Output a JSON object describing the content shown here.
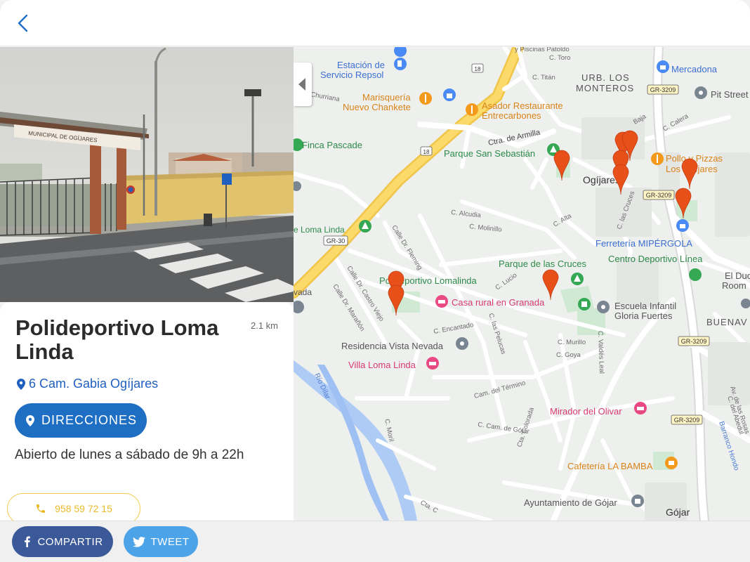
{
  "place": {
    "name": "Polideportivo Loma Linda",
    "distance": "2.1 km",
    "address": "6 Cam. Gabia Ogíjares",
    "directions_label": "DIRECCIONES",
    "hours": "Abierto de lunes a sábado de 9h a 22h",
    "phone": "958 59 72 15"
  },
  "photo": {
    "sign_text": "MUNICIPAL DE OGÍJARES"
  },
  "share": {
    "facebook_label": "COMPARTIR",
    "twitter_label": "TWEET"
  },
  "colors": {
    "primary": "#1e6fc4",
    "facebook": "#3b5998",
    "twitter": "#4da3e8",
    "phone": "#e9b928",
    "marker": "#e8501a"
  },
  "map": {
    "pois": {
      "repsol": "Estación de Servicio Repsol",
      "repsol_1": "Estación de",
      "repsol_2": "Servicio Repsol",
      "marisqueria_1": "Marisquería",
      "marisqueria_2": "Nuevo Chankete",
      "asador_1": "Asador Restaurante",
      "asador_2": "Entrecarbones",
      "finca": "Finca Pascade",
      "parque_sebastian": "Parque San Sebastián",
      "mercadona": "Mercadona",
      "pitstreet": "Pit Street",
      "pollo_1": "Pollo y Pizzas",
      "pollo_2": "Los Ogíjares",
      "ferreteria": "Ferretería MIPÉRGOLA",
      "centro_deportivo": "Centro Deportivo Línea",
      "parque_cruces": "Parque de las Cruces",
      "polideportivo": "Polideportivo Lomalinda",
      "casa_rural": "Casa rural en Granada",
      "escuela_1": "Escuela Infantil",
      "escuela_2": "Gloria Fuertes",
      "residencia": "Residencia Vista Nevada",
      "villa": "Villa Loma Linda",
      "mirador": "Mirador del Olivar",
      "cafeteria": "Cafetería LA BAMBA",
      "ayuntamiento": "Ayuntamiento de Gójar",
      "duo_1": "El Duo",
      "duo_2": "Room"
    },
    "areas": {
      "urb_1": "URB. LOS",
      "urb_2": "MONTEROS",
      "ogijares": "Ogíjares",
      "gojar": "Gójar",
      "buenavista": "BUENAV",
      "loma_linda": "e Loma Linda",
      "nevada": "vada"
    },
    "roads": {
      "gr30": "GR-30",
      "gr3209": "GR-3209",
      "r18": "18",
      "armilla": "Ctra. de Armilla",
      "piscinas": "y Piscinas Patoldo",
      "c_toro": "C. Toro",
      "c_titan": "C. Titán",
      "churriana": "Churriana",
      "c_alcudia": "C. Alcudia",
      "c_molinillo": "C. Molinillo",
      "c_alta": "C. Alta",
      "c_cruces": "C. las Cruces",
      "c_calera": "C. Calera",
      "c_baja": "Baja",
      "c_fleming": "Calle Dr. Fleming",
      "c_castro": "Calle Dr. Castro Viejo",
      "c_maranon": "Calle Dr. Marañón",
      "c_lucio": "C. Lucio",
      "c_encantado": "C. Encantado",
      "c_pelucas": "C. las Pelucas",
      "c_murillo": "C. Murillo",
      "c_goya": "C. Goya",
      "c_valdes": "C. Valdés Leal",
      "c_termino": "Cam. del Término",
      "c_gojar": "C. Cam. de Gójar",
      "c_colorada": "Cta. Colorada",
      "c_moril": "C. Moril",
      "rio_dilar": "Río Dílar",
      "barranco": "Barranco Hondo",
      "c_abedul": "C. del Abedul",
      "av_rosas": "Av. de las Rosas",
      "c_ca": "Cta. C"
    }
  }
}
